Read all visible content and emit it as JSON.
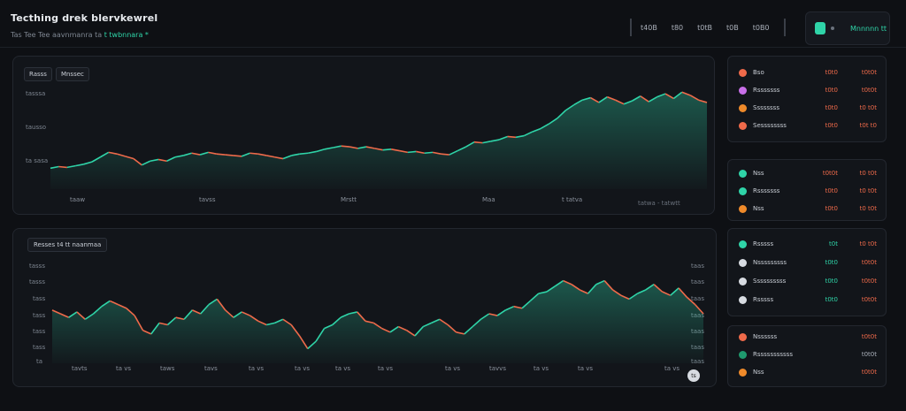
{
  "header": {
    "title": "Tecthing drek blervkewrel",
    "subtitle_prefix": "Tas Tee Tee aavnmanra ta",
    "subtitle_accent": "t twbnnara *",
    "toolbar": [
      "t40B",
      "t80",
      "t0tB",
      "t0B",
      "t0B0"
    ],
    "account_label": "Mnnnnn tt"
  },
  "chart_top": {
    "chips": [
      "Rasss",
      "Mnssec"
    ],
    "y_ticks": [
      "tasssa",
      "tausso",
      "ta sasa"
    ],
    "x_ticks": [
      "taaw",
      "tavss",
      "Mrstt",
      "Maa",
      "t tatva"
    ],
    "footer_badge": "tatwa - tatwtt",
    "line_color": "#2fd4a8",
    "down_color": "#ef6a4a"
  },
  "chart_bottom": {
    "chip": "Resses  t4  tt  naanmaa",
    "y_ticks_left": [
      "tasss",
      "tasss",
      "tass",
      "tass",
      "tass",
      "tass",
      "ta"
    ],
    "y_ticks_right": [
      "taas",
      "taas",
      "taas",
      "taas",
      "taas",
      "taas",
      "taas"
    ],
    "x_ticks": [
      "tavts",
      "ta vs",
      "taws",
      "tavs",
      "ta vs",
      "ta vs",
      "ta vs",
      "ta vs",
      "ta vs",
      "tavvs",
      "ta vs",
      "ta vs",
      "ta vs"
    ],
    "corner_button": "ts"
  },
  "chart_data": [
    {
      "type": "line",
      "title": "",
      "x": [
        0,
        1,
        2,
        3,
        4,
        5,
        6,
        7,
        8,
        9,
        10,
        11,
        12,
        13,
        14,
        15,
        16,
        17,
        18,
        19,
        20,
        21,
        22,
        23,
        24,
        25,
        26,
        27,
        28,
        29,
        30,
        31,
        32,
        33,
        34,
        35,
        36,
        37,
        38,
        39,
        40,
        41,
        42,
        43,
        44,
        45,
        46,
        47,
        48,
        49,
        50,
        51,
        52,
        53,
        54,
        55,
        56,
        57,
        58,
        59,
        60,
        61,
        62,
        63,
        64,
        65,
        66,
        67,
        68,
        69,
        70,
        71,
        72,
        73,
        74,
        75,
        76,
        77,
        78,
        79
      ],
      "values": [
        22,
        24,
        23,
        25,
        27,
        30,
        36,
        42,
        40,
        37,
        34,
        26,
        31,
        33,
        31,
        36,
        38,
        41,
        39,
        42,
        40,
        39,
        38,
        37,
        41,
        40,
        38,
        36,
        34,
        38,
        40,
        41,
        43,
        46,
        48,
        50,
        49,
        47,
        49,
        47,
        45,
        46,
        44,
        42,
        43,
        41,
        42,
        40,
        39,
        44,
        49,
        55,
        54,
        56,
        58,
        62,
        61,
        63,
        68,
        72,
        78,
        85,
        95,
        102,
        108,
        111,
        105,
        112,
        108,
        103,
        107,
        113,
        106,
        112,
        116,
        110,
        118,
        114,
        108,
        105
      ]
    },
    {
      "type": "line",
      "title": "",
      "x": [
        0,
        1,
        2,
        3,
        4,
        5,
        6,
        7,
        8,
        9,
        10,
        11,
        12,
        13,
        14,
        15,
        16,
        17,
        18,
        19,
        20,
        21,
        22,
        23,
        24,
        25,
        26,
        27,
        28,
        29,
        30,
        31,
        32,
        33,
        34,
        35,
        36,
        37,
        38,
        39,
        40,
        41,
        42,
        43,
        44,
        45,
        46,
        47,
        48,
        49,
        50,
        51,
        52,
        53,
        54,
        55,
        56,
        57,
        58,
        59,
        60,
        61,
        62,
        63,
        64,
        65,
        66,
        67,
        68,
        69,
        70,
        71,
        72,
        73,
        74,
        75,
        76,
        77,
        78,
        79
      ],
      "values": [
        52,
        50,
        48,
        51,
        47,
        50,
        54,
        57,
        55,
        53,
        49,
        41,
        39,
        45,
        44,
        48,
        47,
        52,
        50,
        55,
        58,
        52,
        48,
        51,
        49,
        46,
        44,
        45,
        47,
        44,
        38,
        31,
        35,
        42,
        44,
        48,
        50,
        51,
        46,
        45,
        42,
        40,
        43,
        41,
        38,
        43,
        45,
        47,
        44,
        40,
        39,
        43,
        47,
        50,
        49,
        52,
        54,
        53,
        57,
        61,
        62,
        65,
        68,
        66,
        63,
        61,
        66,
        68,
        63,
        60,
        58,
        61,
        63,
        66,
        62,
        60,
        64,
        59,
        55,
        50
      ]
    }
  ],
  "watchlist": [
    {
      "rows": [
        {
          "name": "Bso",
          "price": "t0t0",
          "change": "t0t0t",
          "icon_color": "#ef6a4a",
          "dir": "down"
        },
        {
          "name": "Rsssssss",
          "price": "t0t0",
          "change": "t0t0t",
          "icon_color": "#c86fe8",
          "dir": "down"
        },
        {
          "name": "Ssssssss",
          "price": "t0t0",
          "change": "t0 t0t",
          "icon_color": "#ef8a2a",
          "dir": "down"
        },
        {
          "name": "Sessssssss",
          "price": "t0t0",
          "change": "t0t t0",
          "icon_color": "#ef6a4a",
          "dir": "down"
        }
      ]
    },
    {
      "rows": [
        {
          "name": "Nss",
          "price": "t0t0t",
          "change": "t0 t0t",
          "icon_color": "#2fd4a8",
          "dir": "down"
        },
        {
          "name": "Rsssssss",
          "price": "t0t0",
          "change": "t0 t0t",
          "icon_color": "#2fd4a8",
          "dir": "down"
        },
        {
          "name": "Nss",
          "price": "t0t0",
          "change": "t0 t0t",
          "icon_color": "#ef8a2a",
          "dir": "down"
        }
      ]
    },
    {
      "rows": [
        {
          "name": "Rsssss",
          "price": "t0t",
          "change": "t0 t0t",
          "icon_color": "#2fd4a8",
          "dir": "up"
        },
        {
          "name": "Nsssssssss",
          "price": "t0t0",
          "change": "t0t0t",
          "icon_color": "#d7dbe1",
          "dir": "up"
        },
        {
          "name": "Ssssssssss",
          "price": "t0t0",
          "change": "t0t0t",
          "icon_color": "#d7dbe1",
          "dir": "up"
        },
        {
          "name": "Rsssss",
          "price": "t0t0",
          "change": "t0t0t",
          "icon_color": "#d7dbe1",
          "dir": "up"
        }
      ]
    },
    {
      "rows": [
        {
          "name": "Nssssss",
          "price": "",
          "change": "t0t0t",
          "icon_color": "#ef6a4a",
          "dir": "down"
        },
        {
          "name": "Rsssssssssss",
          "price": "",
          "change": "t0t0t",
          "icon_color": "#1f9a6e",
          "dir": "neutral"
        },
        {
          "name": "Nss",
          "price": "",
          "change": "t0t0t",
          "icon_color": "#ef8a2a",
          "dir": "down"
        }
      ]
    }
  ]
}
